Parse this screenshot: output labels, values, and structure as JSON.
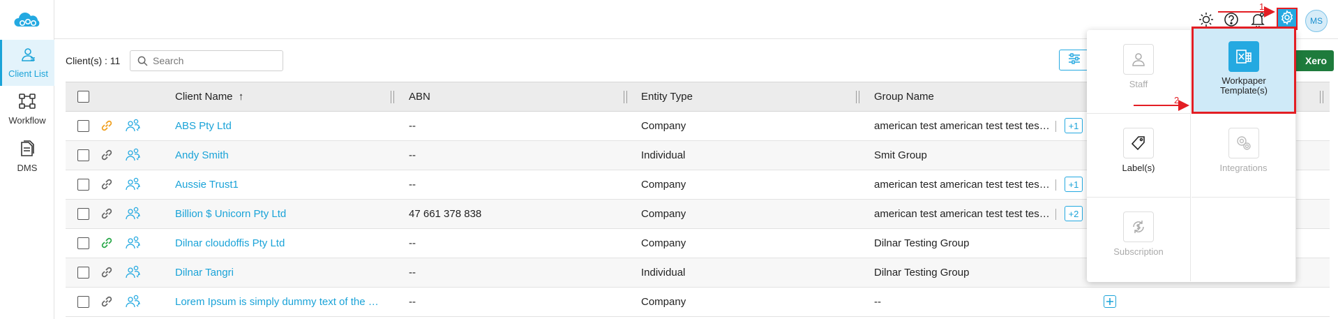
{
  "sidebar": {
    "items": [
      {
        "label": "Client List",
        "icon": "client-list-icon",
        "active": true
      },
      {
        "label": "Workflow",
        "icon": "workflow-icon",
        "active": false
      },
      {
        "label": "DMS",
        "icon": "dms-icon",
        "active": false
      }
    ]
  },
  "header": {
    "avatar_initials": "MS",
    "icons": [
      "theme-sun-icon",
      "help-icon",
      "notification-bell-icon",
      "settings-gear-icon"
    ]
  },
  "toolbar": {
    "client_count_label": "Client(s) : 11",
    "search_placeholder": "Search",
    "xero_button_label": "Xero"
  },
  "table": {
    "columns": [
      "Client Name",
      "ABN",
      "Entity Type",
      "Group Name"
    ],
    "sort_indicator": "↑",
    "rows": [
      {
        "name": "ABS Pty Ltd",
        "abn": "--",
        "type": "Company",
        "group": "american test american test test test...",
        "more": "+1",
        "link_color": "#f0a020"
      },
      {
        "name": "Andy Smith",
        "abn": "--",
        "type": "Individual",
        "group": "Smit Group",
        "more": "",
        "link_color": "#666666"
      },
      {
        "name": "Aussie Trust1",
        "abn": "--",
        "type": "Company",
        "group": "american test american test test test...",
        "more": "+1",
        "link_color": "#666666"
      },
      {
        "name": "Billion $ Unicorn Pty Ltd",
        "abn": "47 661 378 838",
        "type": "Company",
        "group": "american test american test test test...",
        "more": "+2",
        "link_color": "#666666"
      },
      {
        "name": "Dilnar cloudoffis Pty Ltd",
        "abn": "--",
        "type": "Company",
        "group": "Dilnar Testing Group",
        "more": "",
        "link_color": "#2aa84a"
      },
      {
        "name": "Dilnar Tangri",
        "abn": "--",
        "type": "Individual",
        "group": "Dilnar Testing Group",
        "more": "",
        "link_color": "#666666"
      },
      {
        "name": "Lorem Ipsum is simply dummy text of the pr...",
        "abn": "--",
        "type": "Company",
        "group": "--",
        "more": "",
        "link_color": "#666666"
      }
    ]
  },
  "settings_menu": {
    "items": [
      {
        "label": "Staff",
        "icon": "staff-icon",
        "state": "disabled"
      },
      {
        "label": "Workpaper Template(s)",
        "icon": "excel-workpaper-icon",
        "state": "selected"
      },
      {
        "label": "Label(s)",
        "icon": "label-tag-icon",
        "state": "enabled"
      },
      {
        "label": "Integrations",
        "icon": "integrations-gears-icon",
        "state": "disabled"
      },
      {
        "label": "Subscription",
        "icon": "subscription-dollar-icon",
        "state": "disabled"
      }
    ]
  },
  "annotations": {
    "step1": "1",
    "step2": "2",
    "color": "#e31e24"
  },
  "colors": {
    "accent": "#24a9e1",
    "xero_green": "#1e7b3c",
    "highlight": "#e31e24"
  }
}
